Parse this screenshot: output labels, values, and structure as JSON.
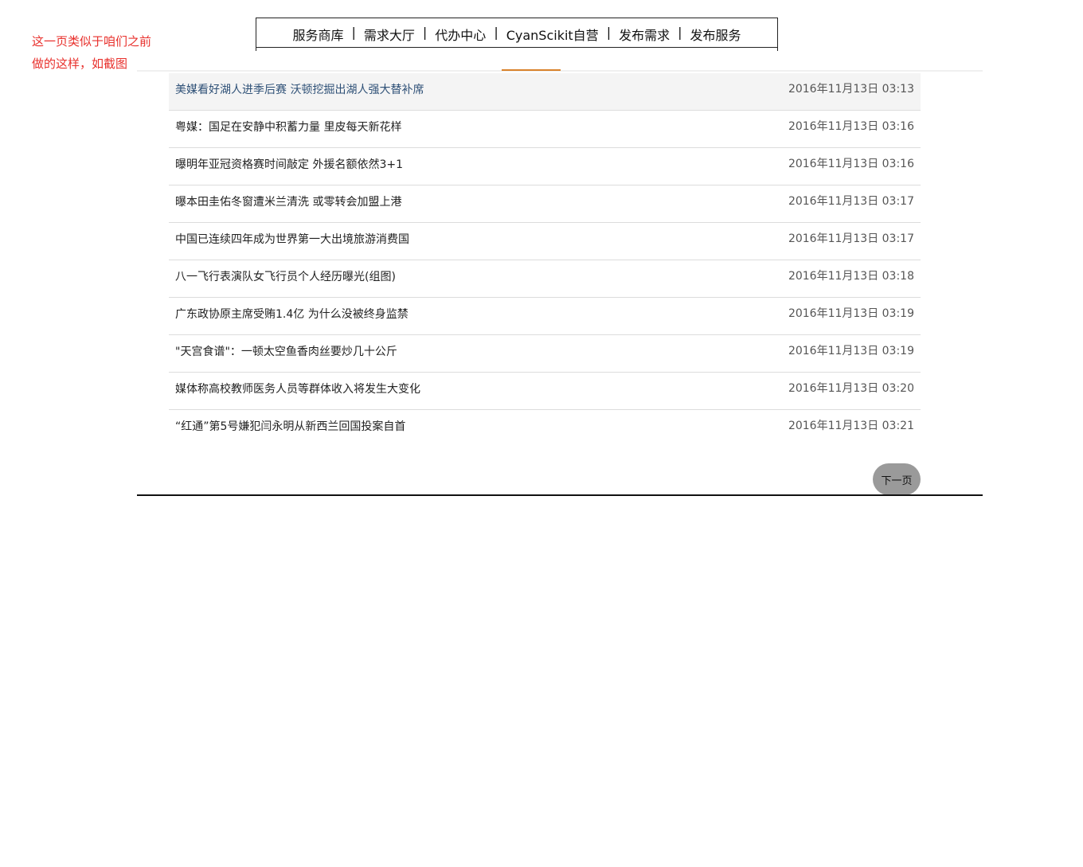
{
  "annotation": {
    "line1": "这一页类似于咱们之前",
    "line2": "做的这样，如截图"
  },
  "nav": {
    "items": [
      "服务商库",
      "需求大厅",
      "代办中心",
      "CyanScikit自营",
      "发布需求",
      "发布服务"
    ],
    "separator": "|"
  },
  "news": [
    {
      "title": "美媒看好湖人进季后赛 沃顿挖掘出湖人强大替补席",
      "time": "2016年11月13日 03:13"
    },
    {
      "title": "粤媒：国足在安静中积蓄力量 里皮每天新花样",
      "time": "2016年11月13日 03:16"
    },
    {
      "title": "曝明年亚冠资格赛时间敲定 外援名额依然3+1",
      "time": "2016年11月13日 03:16"
    },
    {
      "title": "曝本田圭佑冬窗遭米兰清洗 或零转会加盟上港",
      "time": "2016年11月13日 03:17"
    },
    {
      "title": "中国已连续四年成为世界第一大出境旅游消费国",
      "time": "2016年11月13日 03:17"
    },
    {
      "title": "八一飞行表演队女飞行员个人经历曝光(组图)",
      "time": "2016年11月13日 03:18"
    },
    {
      "title": "广东政协原主席受贿1.4亿 为什么没被终身监禁",
      "time": "2016年11月13日 03:19"
    },
    {
      "title": "\"天宫食谱\"：一顿太空鱼香肉丝要炒几十公斤",
      "time": "2016年11月13日 03:19"
    },
    {
      "title": "媒体称高校教师医务人员等群体收入将发生大变化",
      "time": "2016年11月13日 03:20"
    },
    {
      "title": "“红通”第5号嫌犯闫永明从新西兰回国投案自首",
      "time": "2016年11月13日 03:21"
    }
  ],
  "pagination": {
    "next_label": "下一页"
  },
  "colors": {
    "annotation": "#e8302c",
    "active_indicator": "#d9822b",
    "highlight_title": "#2f5177"
  }
}
